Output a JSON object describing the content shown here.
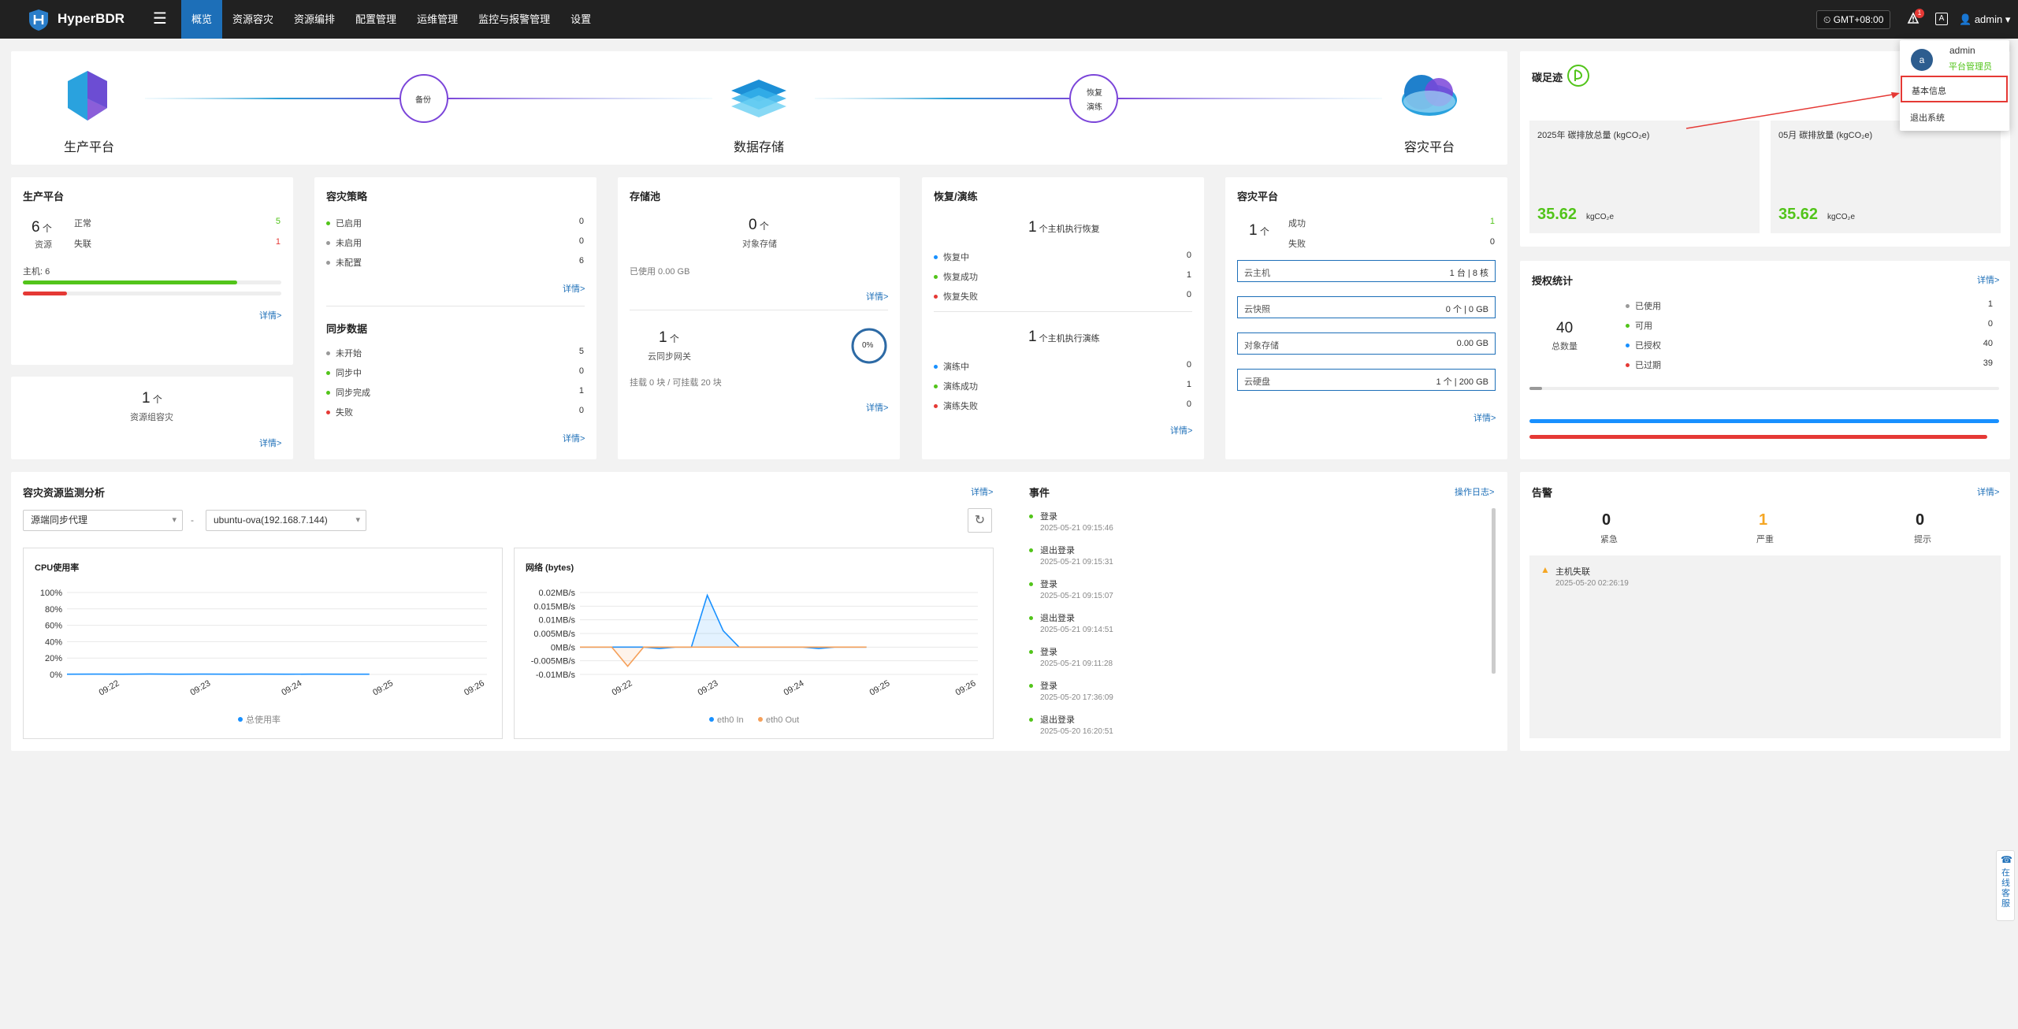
{
  "header": {
    "brand": "HyperBDR",
    "nav": [
      "概览",
      "资源容灾",
      "资源编排",
      "配置管理",
      "运维管理",
      "监控与报警管理",
      "设置"
    ],
    "timezone": "GMT+08:00",
    "bell_count": "1",
    "lang": "A",
    "user": "admin"
  },
  "user_menu": {
    "avatar": "a",
    "name": "admin",
    "role": "平台管理员",
    "items": [
      "基本信息",
      "退出系统"
    ]
  },
  "flow": {
    "source": "生产平台",
    "backup": "备份",
    "storage": "数据存储",
    "restore": "恢复",
    "drill": "演练",
    "target": "容灾平台"
  },
  "carbon": {
    "title": "碳足迹",
    "year_label": "2025年 碳排放总量 (kgCO₂e)",
    "year_value": "35.62",
    "month_label": "05月 碳排放量 (kgCO₂e)",
    "month_value": "35.62",
    "unit": "kgCO₂e"
  },
  "prod": {
    "title": "生产平台",
    "count": "6",
    "count_unit": "个",
    "count_label": "资源",
    "normal_label": "正常",
    "normal": "5",
    "lost_label": "失联",
    "lost": "1",
    "host_label": "主机",
    "host_count": "6",
    "normal_frac": 0.83,
    "lost_frac": 0.17,
    "detail": "详情>"
  },
  "group": {
    "count": "1",
    "unit": "个",
    "label": "资源组容灾",
    "detail": "详情>"
  },
  "policy": {
    "title": "容灾策略",
    "items": [
      {
        "label": "已启用",
        "value": "0",
        "color": "g"
      },
      {
        "label": "未启用",
        "value": "0",
        "color": "gr"
      },
      {
        "label": "未配置",
        "value": "6",
        "color": "gr"
      }
    ],
    "detail": "详情>",
    "sync_title": "同步数据",
    "sync": [
      {
        "label": "未开始",
        "value": "5",
        "color": "gr"
      },
      {
        "label": "同步中",
        "value": "0",
        "color": "g"
      },
      {
        "label": "同步完成",
        "value": "1",
        "color": "g"
      },
      {
        "label": "失败",
        "value": "0",
        "color": "r"
      }
    ],
    "sync_detail": "详情>"
  },
  "storage": {
    "title": "存储池",
    "count": "0",
    "unit": "个",
    "label": "对象存储",
    "used": "已使用 0.00 GB",
    "detail": "详情>",
    "gw_count": "1",
    "gw_unit": "个",
    "gw_label": "云同步网关",
    "mount": "挂载 0 块 / 可挂载 20 块",
    "pct": "0%",
    "gw_detail": "详情>"
  },
  "recover": {
    "title": "恢复/演练",
    "r_head_num": "1",
    "r_head": "个主机执行恢复",
    "r_items": [
      {
        "label": "恢复中",
        "value": "0",
        "color": "b"
      },
      {
        "label": "恢复成功",
        "value": "1",
        "color": "g"
      },
      {
        "label": "恢复失败",
        "value": "0",
        "color": "r"
      }
    ],
    "d_head_num": "1",
    "d_head": "个主机执行演练",
    "d_items": [
      {
        "label": "演练中",
        "value": "0",
        "color": "b"
      },
      {
        "label": "演练成功",
        "value": "1",
        "color": "g"
      },
      {
        "label": "演练失败",
        "value": "0",
        "color": "r"
      }
    ],
    "detail": "详情>"
  },
  "dr": {
    "title": "容灾平台",
    "count": "1",
    "unit": "个",
    "success_label": "成功",
    "success": "1",
    "fail_label": "失败",
    "fail": "0",
    "boxes": [
      {
        "label": "云主机",
        "value": "1 台  |  8 核"
      },
      {
        "label": "云快照",
        "value": "0 个  |  0 GB"
      },
      {
        "label": "对象存储",
        "value": "0.00 GB"
      },
      {
        "label": "云硬盘",
        "value": "1 个  |  200 GB"
      }
    ],
    "detail": "详情>"
  },
  "license": {
    "title": "授权统计",
    "detail": "详情>",
    "total": "40",
    "total_label": "总数量",
    "items": [
      {
        "label": "已使用",
        "value": "1",
        "color": "gr"
      },
      {
        "label": "可用",
        "value": "0",
        "color": "g"
      },
      {
        "label": "已授权",
        "value": "40",
        "color": "b"
      },
      {
        "label": "已过期",
        "value": "39",
        "color": "r"
      }
    ]
  },
  "monitor": {
    "title": "容灾资源监测分析",
    "detail": "详情>",
    "select1": "源端同步代理",
    "dash": "-",
    "select2": "ubuntu-ova(192.168.7.144)"
  },
  "events": {
    "title": "事件",
    "log": "操作日志>",
    "items": [
      {
        "name": "登录",
        "time": "2025-05-21 09:15:46"
      },
      {
        "name": "退出登录",
        "time": "2025-05-21 09:15:31"
      },
      {
        "name": "登录",
        "time": "2025-05-21 09:15:07"
      },
      {
        "name": "退出登录",
        "time": "2025-05-21 09:14:51"
      },
      {
        "name": "登录",
        "time": "2025-05-21 09:11:28"
      },
      {
        "name": "登录",
        "time": "2025-05-20 17:36:09"
      },
      {
        "name": "退出登录",
        "time": "2025-05-20 16:20:51"
      }
    ]
  },
  "alerts": {
    "title": "告警",
    "detail": "详情>",
    "urgent": "0",
    "urgent_label": "紧急",
    "severe": "1",
    "severe_label": "严重",
    "hint": "0",
    "hint_label": "提示",
    "item_name": "主机失联",
    "item_time": "2025-05-20 02:26:19"
  },
  "service": {
    "label": "在线客服"
  },
  "chart_data": [
    {
      "type": "line",
      "title": "CPU使用率",
      "x": [
        "09:22",
        "09:23",
        "09:24",
        "09:25",
        "09:26"
      ],
      "yticks": [
        "100%",
        "80%",
        "60%",
        "40%",
        "20%",
        "0%"
      ],
      "ylim": [
        0,
        100
      ],
      "series": [
        {
          "name": "总使用率",
          "color": "#1890ff",
          "values": [
            0.3,
            0.4,
            0.3,
            0.5,
            0.3,
            0.4,
            0.3,
            0.4,
            0.3,
            0.4,
            0.3,
            0.3
          ]
        }
      ],
      "grid": true,
      "legend": "bottom"
    },
    {
      "type": "line",
      "title": "网络 (bytes)",
      "x": [
        "09:22",
        "09:23",
        "09:24",
        "09:25",
        "09:26"
      ],
      "yticks": [
        "0.02MB/s",
        "0.015MB/s",
        "0.01MB/s",
        "0.005MB/s",
        "0MB/s",
        "-0.005MB/s",
        "-0.01MB/s"
      ],
      "ylim": [
        -0.01,
        0.02
      ],
      "series": [
        {
          "name": "eth0 In",
          "color": "#1890ff",
          "values": [
            0,
            0,
            0,
            0,
            0,
            -0.0005,
            0,
            0,
            0.019,
            0.006,
            0,
            0,
            0,
            0,
            0,
            -0.0005,
            0,
            0,
            0
          ]
        },
        {
          "name": "eth0 Out",
          "color": "#f5a05a",
          "values": [
            0,
            0,
            0,
            -0.007,
            0,
            0,
            0,
            0,
            0,
            0,
            0,
            0,
            0,
            0,
            0,
            0,
            0,
            0,
            0
          ]
        }
      ],
      "grid": true,
      "legend": "bottom"
    }
  ]
}
